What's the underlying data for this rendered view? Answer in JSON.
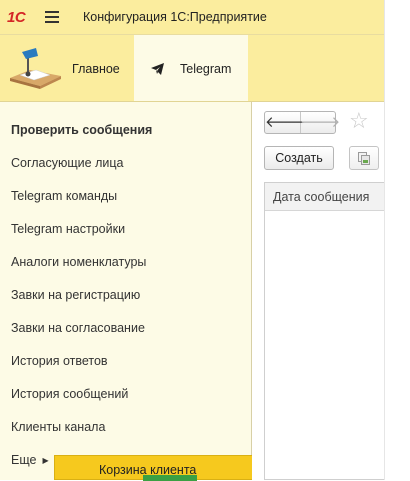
{
  "header": {
    "logo": "1С",
    "app_title": "Конфигурация 1С:Предприятие"
  },
  "sections": [
    {
      "label": "Главное",
      "icon": "desk-lamp-icon",
      "active": false
    },
    {
      "label": "Telegram",
      "icon": "telegram-plane-icon",
      "active": true
    }
  ],
  "nav": {
    "items": [
      {
        "label": "Проверить сообщения",
        "bold": true
      },
      {
        "label": "Согласующие лица"
      },
      {
        "label": "Telegram команды"
      },
      {
        "label": "Telegram настройки"
      },
      {
        "label": "Аналоги номенклатуры"
      },
      {
        "label": "Завки на регистрацию"
      },
      {
        "label": "Завки на согласование"
      },
      {
        "label": "История ответов"
      },
      {
        "label": "История сообщений"
      },
      {
        "label": "Клиенты канала"
      }
    ],
    "more_label": "Еще"
  },
  "popup": {
    "item_label": "Корзина клиента"
  },
  "toolbar": {
    "back_icon": "arrow-left-icon",
    "forward_icon": "arrow-right-icon",
    "favorite_icon": "star-icon",
    "create_label": "Создать",
    "copy_icon": "copy-icon"
  },
  "table": {
    "columns": [
      "Дата сообщения"
    ]
  },
  "colors": {
    "top_bar": "#fbed9e",
    "panel": "#fdfbe6",
    "popup_highlight": "#f6c91e",
    "logo_red": "#d42626"
  }
}
